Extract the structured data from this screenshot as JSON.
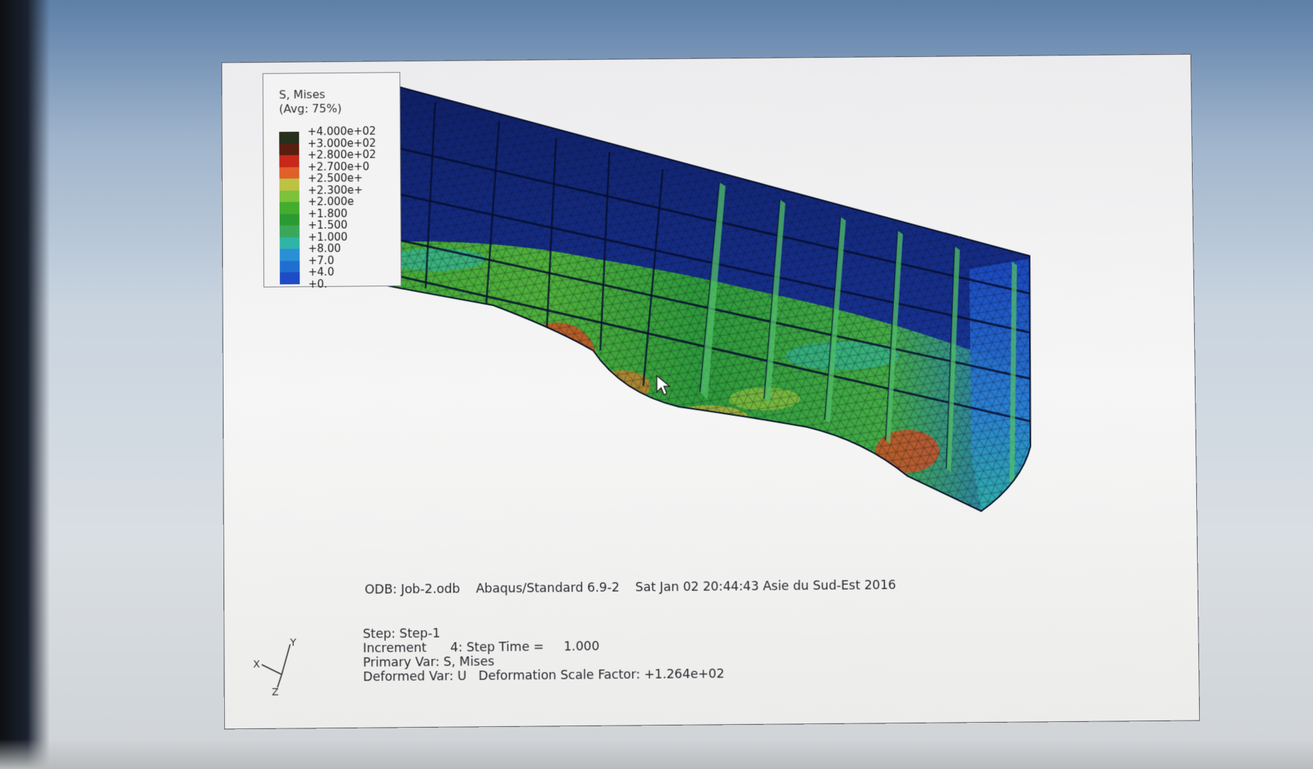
{
  "legend": {
    "title_line1": "S, Mises",
    "title_line2": "(Avg: 75%)",
    "entries": [
      {
        "label": "+4.000e+02",
        "color": "#26301c"
      },
      {
        "label": "+3.000e+02",
        "color": "#5a1e10"
      },
      {
        "label": "+2.800e+02",
        "color": "#c7281a"
      },
      {
        "label": "+2.700e+0",
        "color": "#e0602a"
      },
      {
        "label": "+2.500e+",
        "color": "#bcc242"
      },
      {
        "label": "+2.300e+",
        "color": "#7cc23a"
      },
      {
        "label": "+2.000e",
        "color": "#44ad2e"
      },
      {
        "label": "+1.800",
        "color": "#2c9a32"
      },
      {
        "label": "+1.500",
        "color": "#3aa85a"
      },
      {
        "label": "+1.000",
        "color": "#2fb4a8"
      },
      {
        "label": "+8.00",
        "color": "#2a90d6"
      },
      {
        "label": "+7.0",
        "color": "#1f6fd0"
      },
      {
        "label": "+4.0",
        "color": "#1e4cc6"
      },
      {
        "label": "+0.",
        "color": "#1b2e9e"
      }
    ]
  },
  "info": {
    "odb_line": "ODB: Job-2.odb    Abaqus/Standard 6.9-2    Sat Jan 02 20:44:43 Asie du Sud-Est 2016",
    "step_line": "Step: Step-1",
    "increment_line": "Increment      4: Step Time =     1.000",
    "primary_var_line": "Primary Var: S, Mises",
    "deformed_var_line": "Deformed Var: U   Deformation Scale Factor: +1.264e+02"
  },
  "triad": {
    "x_label": "X",
    "y_label": "Y",
    "z_label": "Z"
  },
  "colors": {
    "mesh_line": "#0b1020",
    "high_stress": "#d24a22",
    "mid_stress": "#3ea636",
    "low_stress": "#1b3aa8"
  }
}
